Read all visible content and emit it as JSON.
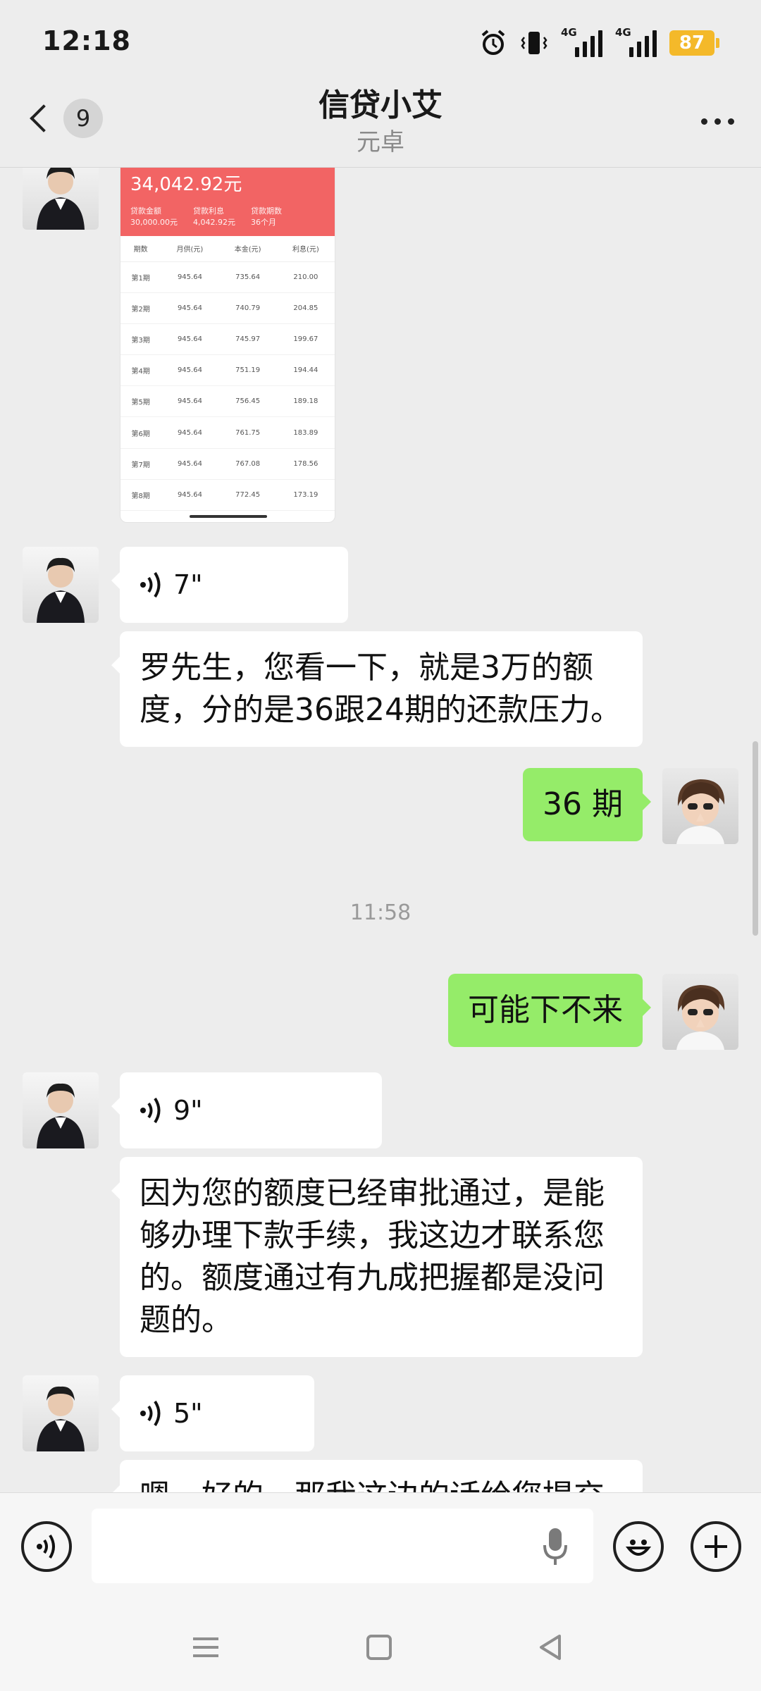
{
  "status_bar": {
    "time": "12:18",
    "network_1": "4G",
    "network_2": "4G",
    "battery": "87",
    "battery_color": "#f4b92a"
  },
  "header": {
    "unread_count": "9",
    "title": "信贷小艾",
    "subtitle": "元卓",
    "back_icon": "chevron-left-icon",
    "more_icon": "ellipsis-icon"
  },
  "image_message": {
    "total": "34,042.92元",
    "meta": [
      {
        "label": "贷款金额",
        "value": "30,000.00元"
      },
      {
        "label": "贷款利息",
        "value": "4,042.92元"
      },
      {
        "label": "贷款期数",
        "value": "36个月"
      }
    ],
    "columns": [
      "期数",
      "月供(元)",
      "本金(元)",
      "利息(元)"
    ],
    "rows": [
      [
        "第1期",
        "945.64",
        "735.64",
        "210.00"
      ],
      [
        "第2期",
        "945.64",
        "740.79",
        "204.85"
      ],
      [
        "第3期",
        "945.64",
        "745.97",
        "199.67"
      ],
      [
        "第4期",
        "945.64",
        "751.19",
        "194.44"
      ],
      [
        "第5期",
        "945.64",
        "756.45",
        "189.18"
      ],
      [
        "第6期",
        "945.64",
        "761.75",
        "183.89"
      ],
      [
        "第7期",
        "945.64",
        "767.08",
        "178.56"
      ],
      [
        "第8期",
        "945.64",
        "772.45",
        "173.19"
      ]
    ]
  },
  "messages": {
    "voice_1": "7\"",
    "text_1": "罗先生，您看一下，就是3万的额度，分的是36跟24期的还款压力。",
    "user_1": "36 期",
    "time_1": "11:58",
    "user_2": "可能下不来",
    "voice_2": "9\"",
    "text_2": "因为您的额度已经审批通过，是能够办理下款手续，我这边才联系您的。额度通过有九成把握都是没问题的。",
    "voice_3": "5\"",
    "text_3_partial": "嗯，好的，那我这边的话给您提交"
  },
  "colors": {
    "user_bubble": "#95ec69",
    "background": "#ededed",
    "image_header": "#f26464"
  }
}
